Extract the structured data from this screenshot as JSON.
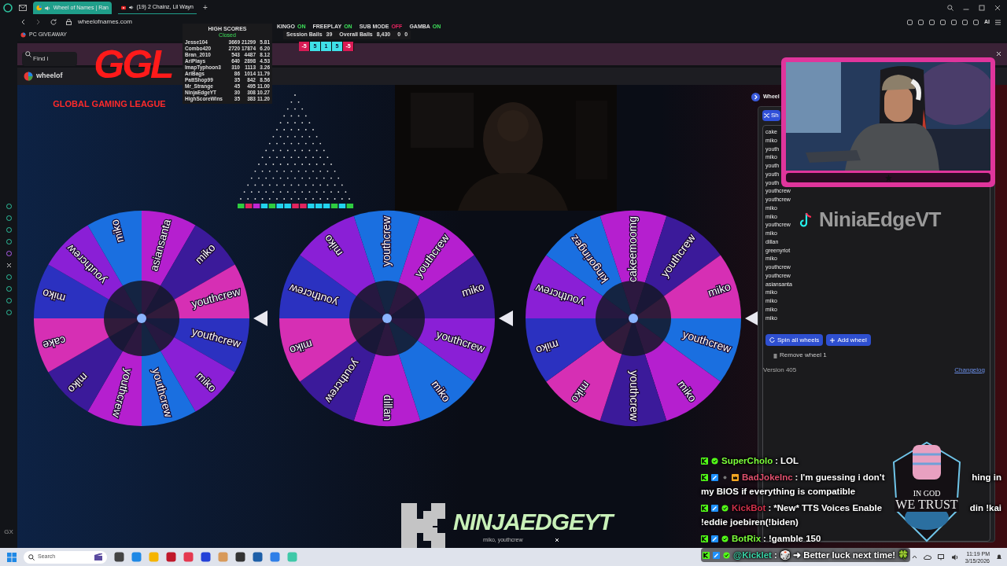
{
  "browser": {
    "tabs": [
      {
        "title": "Wheel of Names | Ran",
        "selected": true
      },
      {
        "title": "(19) 2 Chainz, Lil Wayn",
        "selected": false
      }
    ],
    "new_tab": "+",
    "url": "wheelofnames.com",
    "bookmark": "PC GIVEAWAY",
    "toolbar_label": "AI"
  },
  "page": {
    "search_placeholder": "Find i",
    "site_title": "wheelof",
    "wheel_panel_title": "Wheel",
    "shuffle_button": "Sh",
    "entries": [
      "cake",
      "miko",
      "youth",
      "miko",
      "youth",
      "youth",
      "youth",
      "youthcrew",
      "youthcrew",
      "miko",
      "miko",
      "youthcrew",
      "miko",
      "dillan",
      "greenyriot",
      "miko",
      "youthcrew",
      "youthcrew",
      "asiansanta",
      "miko",
      "miko",
      "miko",
      "miko"
    ],
    "spin_button": "Spin all wheels",
    "add_button": "Add wheel",
    "remove_link": "Remove wheel 1",
    "version": "Version 405",
    "changelog": "Changelog",
    "sidebar_label": "GX"
  },
  "wheels": [
    {
      "labels": [
        "youthcrew",
        "miko",
        "youthcrew",
        "youthcrew",
        "miko",
        "cake",
        "miko",
        "youthcrew",
        "miko",
        "asiansanta",
        "miko",
        "youthcrew"
      ]
    },
    {
      "labels": [
        "youthcrew",
        "miko",
        "dillan",
        "youthcrew",
        "miko",
        "youthcrew",
        "miko",
        "youthcrew",
        "youthcrew",
        "miko"
      ]
    },
    {
      "labels": [
        "youthcrew",
        "miko",
        "youthcrew",
        "miko",
        "miko",
        "youthcrew",
        "kingoringez",
        "cakeemoomg",
        "youthcrew",
        "miko"
      ]
    }
  ],
  "overlays": {
    "logo": {
      "letters": "GGL",
      "subtitle": "GLOBAL GAMING LEAGUE"
    },
    "high_scores": {
      "title": "HIGH SCORES",
      "subtitle": "Closed",
      "rows": [
        {
          "name": "Jesse104",
          "cells": [
            "3669",
            "21299",
            "5.81"
          ]
        },
        {
          "name": "Combo420",
          "cells": [
            "2720",
            "17874",
            "6.20"
          ]
        },
        {
          "name": "Bran_2010",
          "cells": [
            "543",
            "4487",
            "8.12"
          ]
        },
        {
          "name": "AriPlays",
          "cells": [
            "640",
            "2898",
            "4.53"
          ]
        },
        {
          "name": "ImapTyphoon3",
          "cells": [
            "310",
            "1113",
            "3.26"
          ]
        },
        {
          "name": "AriBags",
          "cells": [
            "86",
            "1014",
            "11.79"
          ]
        },
        {
          "name": "PattShop99",
          "cells": [
            "35",
            "842",
            "8.56"
          ]
        },
        {
          "name": "Mr_Strange",
          "cells": [
            "45",
            "495",
            "11.00"
          ]
        },
        {
          "name": "NinjaEdgeYT",
          "cells": [
            "30",
            "308",
            "10.27"
          ]
        },
        {
          "name": "HighScoreWins",
          "cells": [
            "35",
            "383",
            "11.20"
          ]
        }
      ]
    },
    "toggles": [
      {
        "label": "KINGO",
        "state": "ON",
        "on": true
      },
      {
        "label": "FREEPLAY",
        "state": "ON",
        "on": true
      },
      {
        "label": "SUB MODE",
        "state": "OFF",
        "on": false
      },
      {
        "label": "GAMBA",
        "state": "ON",
        "on": true
      }
    ],
    "balls": [
      {
        "label": "Session Balls",
        "value": "39"
      },
      {
        "label": "Overall Balls",
        "value": "8,430"
      },
      {
        "label": "0",
        "value": "0"
      }
    ],
    "multipliers": [
      {
        "label": "-5",
        "kind": "loss"
      },
      {
        "label": "5",
        "kind": "win"
      },
      {
        "label": "1",
        "kind": "win"
      },
      {
        "label": "5",
        "kind": "win"
      },
      {
        "label": "-5",
        "kind": "loss"
      }
    ],
    "plinko_slots": [
      {
        "color": "#2ecc40"
      },
      {
        "color": "#e0245e"
      },
      {
        "color": "#c026d3"
      },
      {
        "color": "#22d3ee"
      },
      {
        "color": "#2ecc40"
      },
      {
        "color": "#22d3ee"
      },
      {
        "color": "#22d3ee"
      },
      {
        "color": "#e0245e"
      },
      {
        "color": "#e0245e"
      },
      {
        "color": "#22d3ee"
      },
      {
        "color": "#22d3ee"
      },
      {
        "color": "#22d3ee"
      },
      {
        "color": "#2ecc40"
      },
      {
        "color": "#22d3ee"
      },
      {
        "color": "#2ecc40"
      }
    ],
    "tiktok_handle": "NiniaEdgeVT",
    "banner": "NINJAEDGEYT",
    "banner_subtext": "miko, youthcrew",
    "emblem": [
      "IN GOD",
      "WE TRUST"
    ]
  },
  "chat": [
    {
      "user": "SuperCholo",
      "color": "#7cfc3a",
      "badges": [
        {
          "kind": "kick"
        },
        {
          "kind": "verified"
        }
      ],
      "separator": ":",
      "lines": [
        [
          "LOL"
        ]
      ]
    },
    {
      "user": "BadJokeInc",
      "color": "#e0506e",
      "badges": [
        {
          "kind": "kick"
        },
        {
          "kind": "mod"
        },
        {
          "kind": "pin"
        },
        {
          "kind": "sub"
        }
      ],
      "separator": ":",
      "lines": [
        [
          "I'm guessing i don't",
          "hing in"
        ],
        [
          "my BIOS if everything is compatible"
        ]
      ]
    },
    {
      "user": "KickBot",
      "color": "#d0304a",
      "badges": [
        {
          "kind": "kick"
        },
        {
          "kind": "mod"
        },
        {
          "kind": "verified"
        }
      ],
      "separator": ":",
      "lines": [
        [
          "*New* TTS Voices Enable",
          "din !kai"
        ],
        [
          "!eddie joebiren(!biden)"
        ]
      ]
    },
    {
      "user": "BotRix",
      "color": "#7cfc3a",
      "badges": [
        {
          "kind": "kick"
        },
        {
          "kind": "mod"
        },
        {
          "kind": "verified"
        }
      ],
      "separator": ":",
      "lines": [
        [
          "!gamble 150"
        ]
      ]
    },
    {
      "user": "@Kicklet",
      "color": "#3ad6a8",
      "badges": [
        {
          "kind": "kick"
        },
        {
          "kind": "mod"
        },
        {
          "kind": "verified"
        }
      ],
      "separator": ":",
      "lines": [
        [
          "🎲 ➜ Better luck next time! 🍀"
        ]
      ]
    }
  ],
  "taskbar": {
    "search": "Search",
    "time": "11:19 PM",
    "date": "3/15/2026"
  }
}
